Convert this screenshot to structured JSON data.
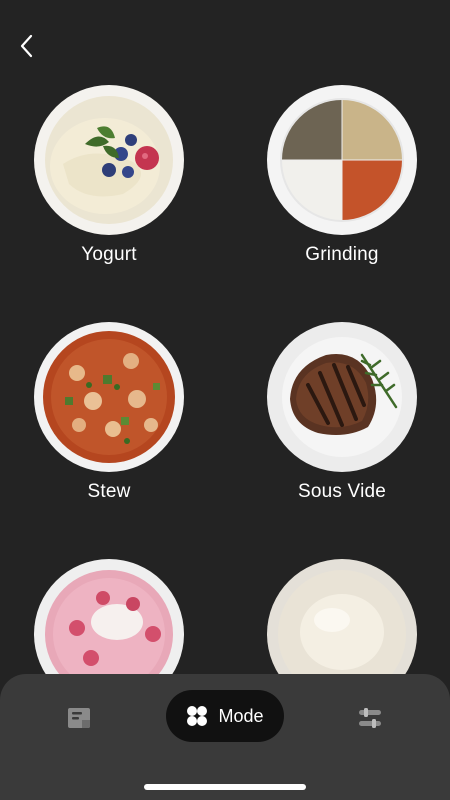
{
  "header": {
    "back_icon": "chevron-left-icon"
  },
  "modes": [
    {
      "label": "Yogurt"
    },
    {
      "label": "Grinding"
    },
    {
      "label": "Stew"
    },
    {
      "label": "Sous Vide"
    },
    {
      "label": ""
    },
    {
      "label": ""
    }
  ],
  "bottom_nav": {
    "recipes_icon": "recipe-book-icon",
    "mode_label": "Mode",
    "mode_icon": "four-petal-icon",
    "settings_icon": "sliders-icon"
  },
  "colors": {
    "background": "#232323",
    "bottom_bar": "#3a3a3a",
    "active_tab": "#111111",
    "inactive_icon": "#8a8a8a"
  }
}
